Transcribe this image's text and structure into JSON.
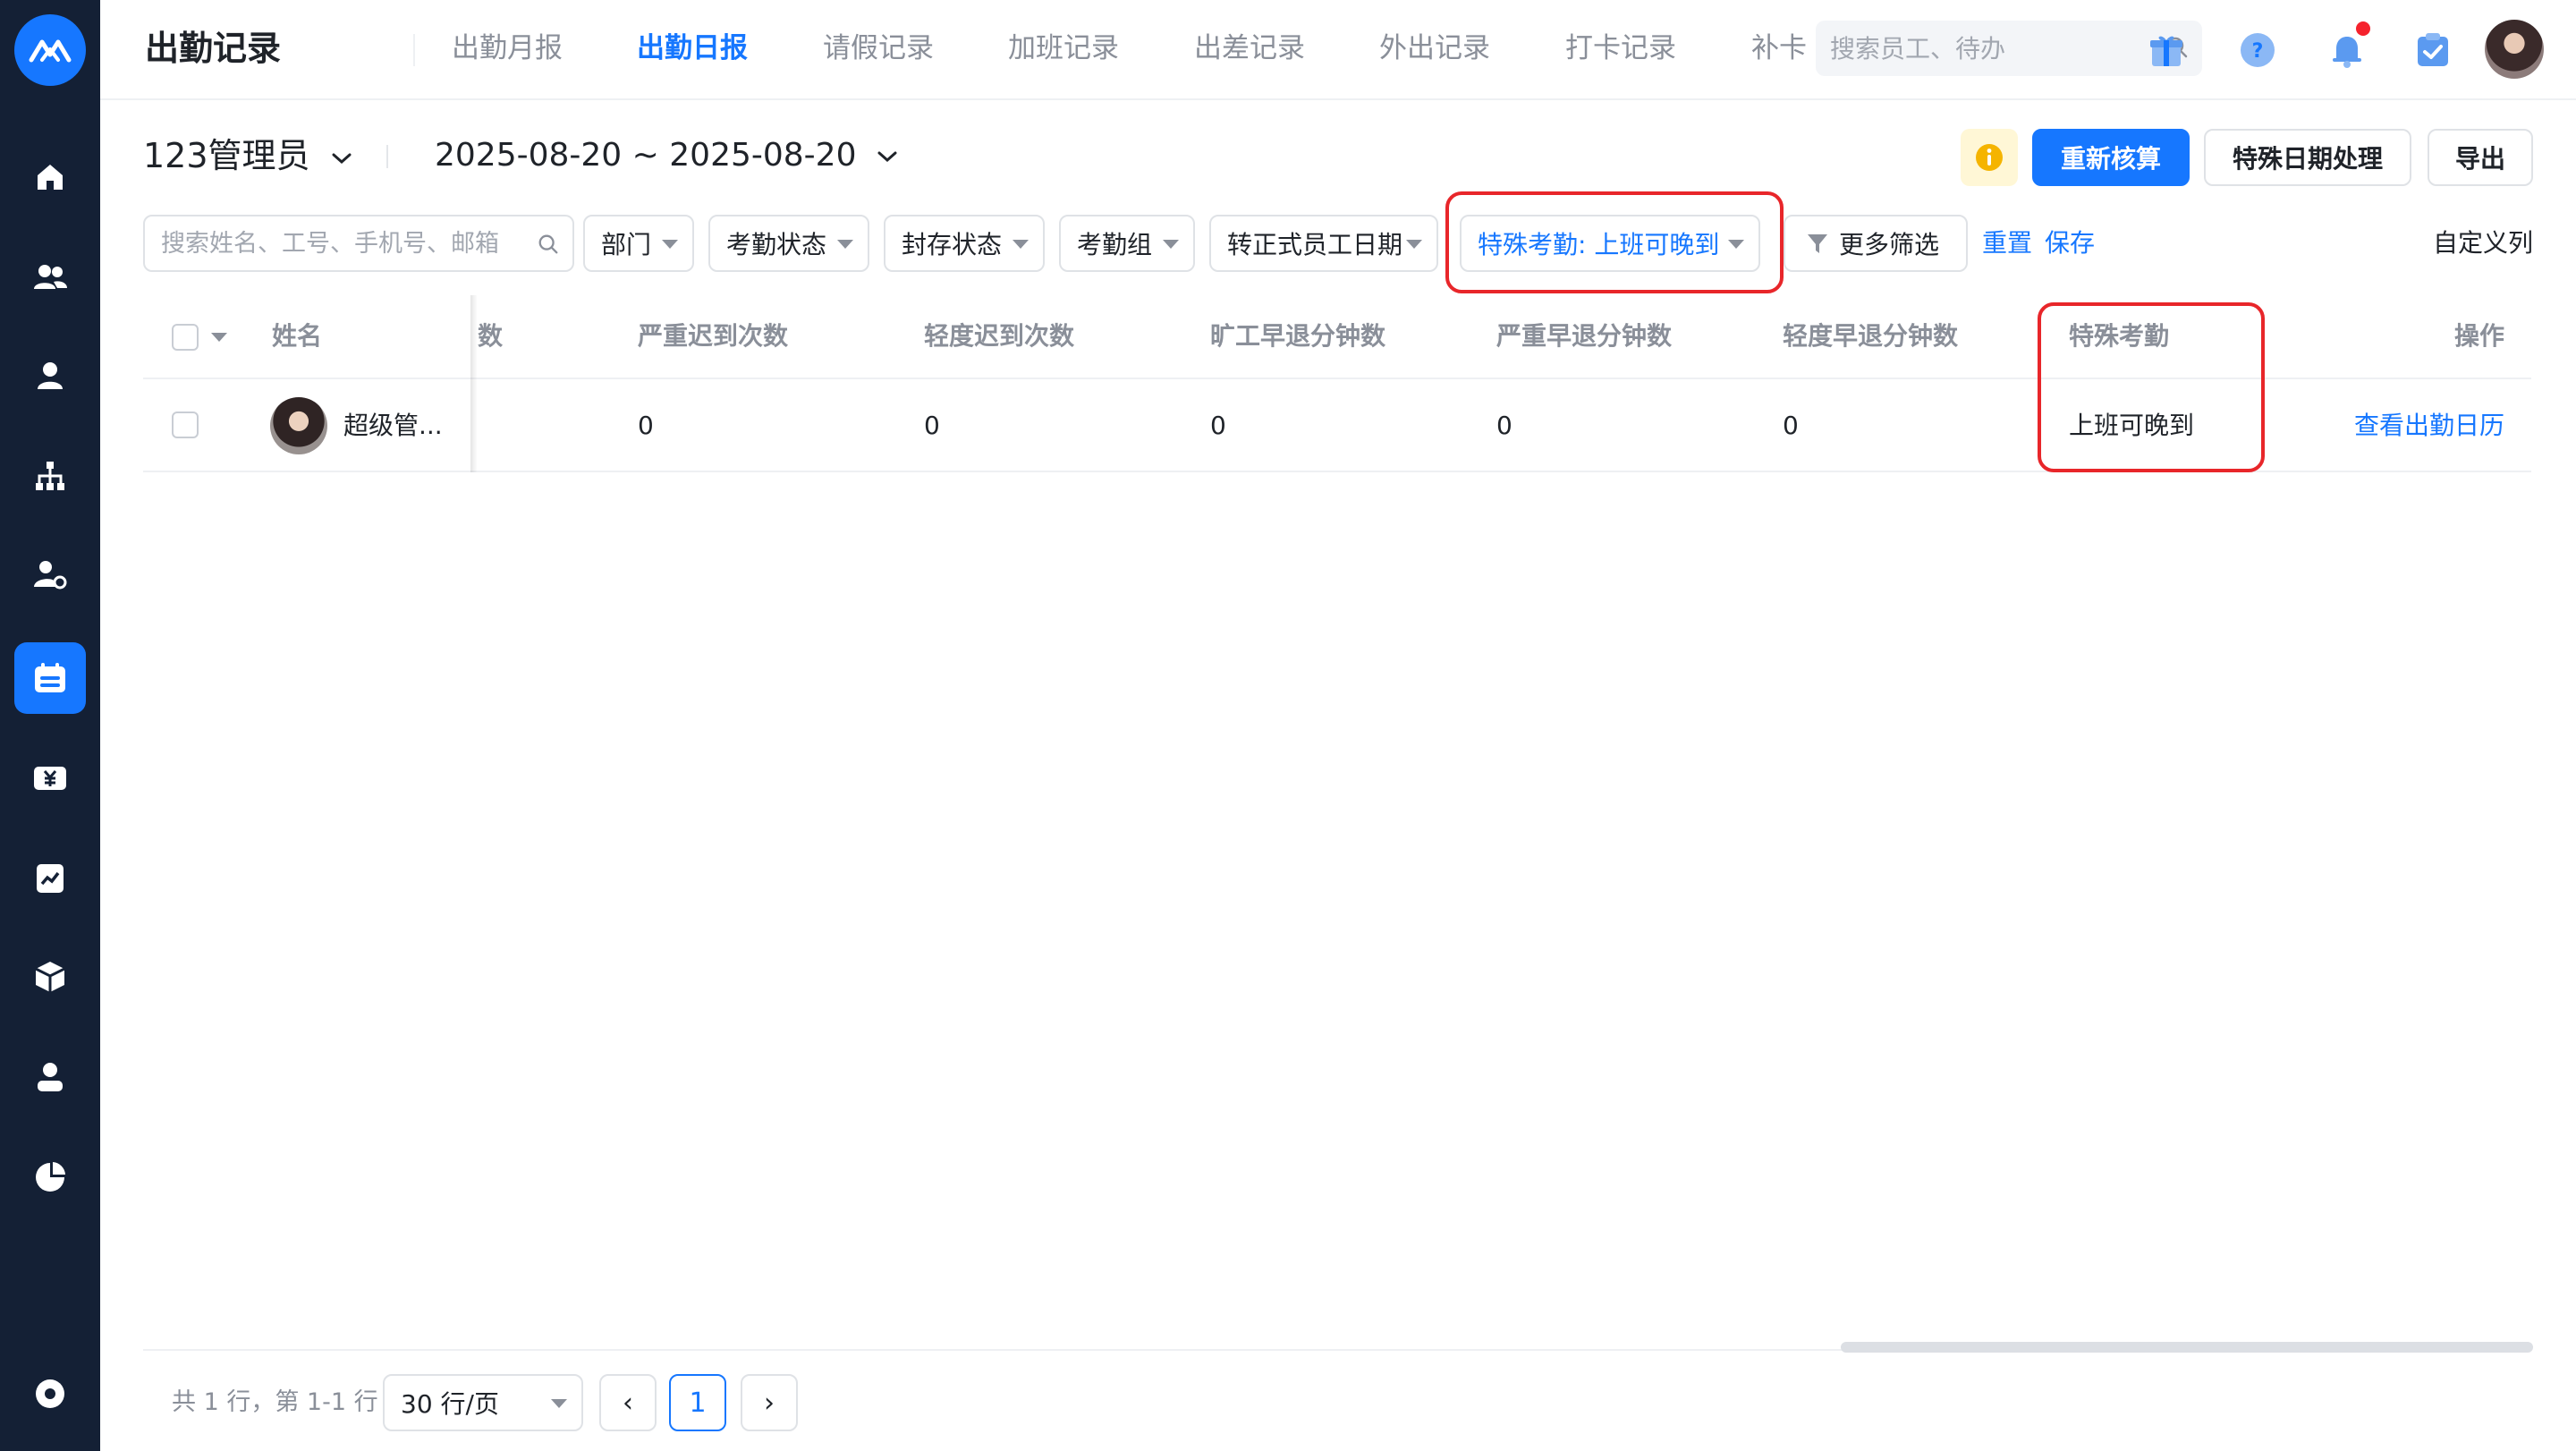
{
  "header": {
    "title": "出勤记录",
    "tabs": [
      {
        "label": "出勤月报",
        "active": false
      },
      {
        "label": "出勤日报",
        "active": true
      },
      {
        "label": "请假记录",
        "active": false
      },
      {
        "label": "加班记录",
        "active": false
      },
      {
        "label": "出差记录",
        "active": false
      },
      {
        "label": "外出记录",
        "active": false
      },
      {
        "label": "打卡记录",
        "active": false
      },
      {
        "label": "补卡",
        "active": false
      }
    ],
    "search_placeholder": "搜索员工、待办"
  },
  "toolbar": {
    "admin_label": "123管理员",
    "date_range": "2025-08-20 ~ 2025-08-20",
    "recalc_label": "重新核算",
    "special_date_label": "特殊日期处理",
    "export_label": "导出"
  },
  "filters": {
    "search_placeholder": "搜索姓名、工号、手机号、邮箱",
    "dept": "部门",
    "attendance_status": "考勤状态",
    "archive_status": "封存状态",
    "attendance_group": "考勤组",
    "regular_date": "转正式员工日期",
    "special_attendance": "特殊考勤: 上班可晚到",
    "more_filter": "更多筛选",
    "reset": "重置",
    "save": "保存",
    "custom_columns": "自定义列"
  },
  "table": {
    "headers": {
      "name": "姓名",
      "partial": "次数",
      "severe_late": "严重迟到次数",
      "mild_late": "轻度迟到次数",
      "absent_early_minutes": "旷工早退分钟数",
      "severe_early_minutes": "严重早退分钟数",
      "mild_early_minutes": "轻度早退分钟数",
      "special_attendance": "特殊考勤",
      "actions": "操作"
    },
    "rows": [
      {
        "name": "超级管...",
        "severe_late": "0",
        "mild_late": "0",
        "absent_early_minutes": "0",
        "severe_early_minutes": "0",
        "mild_early_minutes": "0",
        "special_attendance": "上班可晚到",
        "action": "查看出勤日历"
      }
    ]
  },
  "pagination": {
    "info": "共 1 行，第 1-1 行",
    "page_size": "30 行/页",
    "prev": "‹",
    "current_page": "1",
    "next": "›"
  },
  "colors": {
    "sidebar_bg": "#142035",
    "accent": "#1677ff",
    "highlight_box": "#e8262a",
    "notification_dot": "#f5222d"
  },
  "icons": {
    "sidebar": [
      "home-icon",
      "team-icon",
      "person-icon",
      "org-chart-icon",
      "user-settings-icon",
      "calendar-icon",
      "payroll-icon",
      "report-icon",
      "box-icon",
      "profile-icon",
      "pie-chart-icon",
      "settings-icon"
    ],
    "header": [
      "gift-icon",
      "help-icon",
      "bell-icon",
      "todo-check-icon"
    ]
  }
}
